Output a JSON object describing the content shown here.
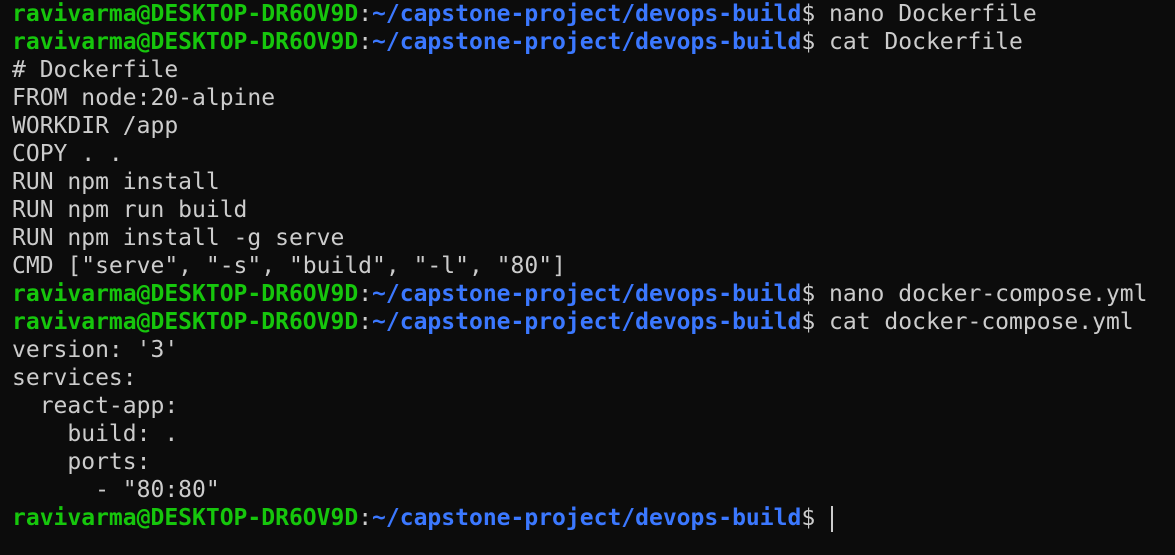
{
  "theme": {
    "background": "#0c0c0c",
    "foreground": "#cccccc",
    "user_color": "#16c60c",
    "path_color": "#3b78ff"
  },
  "prompt": {
    "user_host": "ravivarma@DESKTOP-DR6OV9D",
    "separator": ":",
    "path": "~/capstone-project/devops-build",
    "symbol": "$"
  },
  "lines": [
    {
      "type": "prompt",
      "command": " nano Dockerfile"
    },
    {
      "type": "prompt",
      "command": " cat Dockerfile"
    },
    {
      "type": "output",
      "text": "# Dockerfile"
    },
    {
      "type": "output",
      "text": "FROM node:20-alpine"
    },
    {
      "type": "output",
      "text": "WORKDIR /app"
    },
    {
      "type": "output",
      "text": "COPY . ."
    },
    {
      "type": "output",
      "text": "RUN npm install"
    },
    {
      "type": "output",
      "text": "RUN npm run build"
    },
    {
      "type": "output",
      "text": "RUN npm install -g serve"
    },
    {
      "type": "output",
      "text": "CMD [\"serve\", \"-s\", \"build\", \"-l\", \"80\"]"
    },
    {
      "type": "prompt",
      "command": " nano docker-compose.yml"
    },
    {
      "type": "prompt",
      "command": " cat docker-compose.yml"
    },
    {
      "type": "output",
      "text": "version: '3'"
    },
    {
      "type": "output",
      "text": "services:"
    },
    {
      "type": "output",
      "text": "  react-app:"
    },
    {
      "type": "output",
      "text": "    build: ."
    },
    {
      "type": "output",
      "text": "    ports:"
    },
    {
      "type": "output",
      "text": "      - \"80:80\""
    },
    {
      "type": "prompt",
      "command": " ",
      "cursor": true
    }
  ]
}
